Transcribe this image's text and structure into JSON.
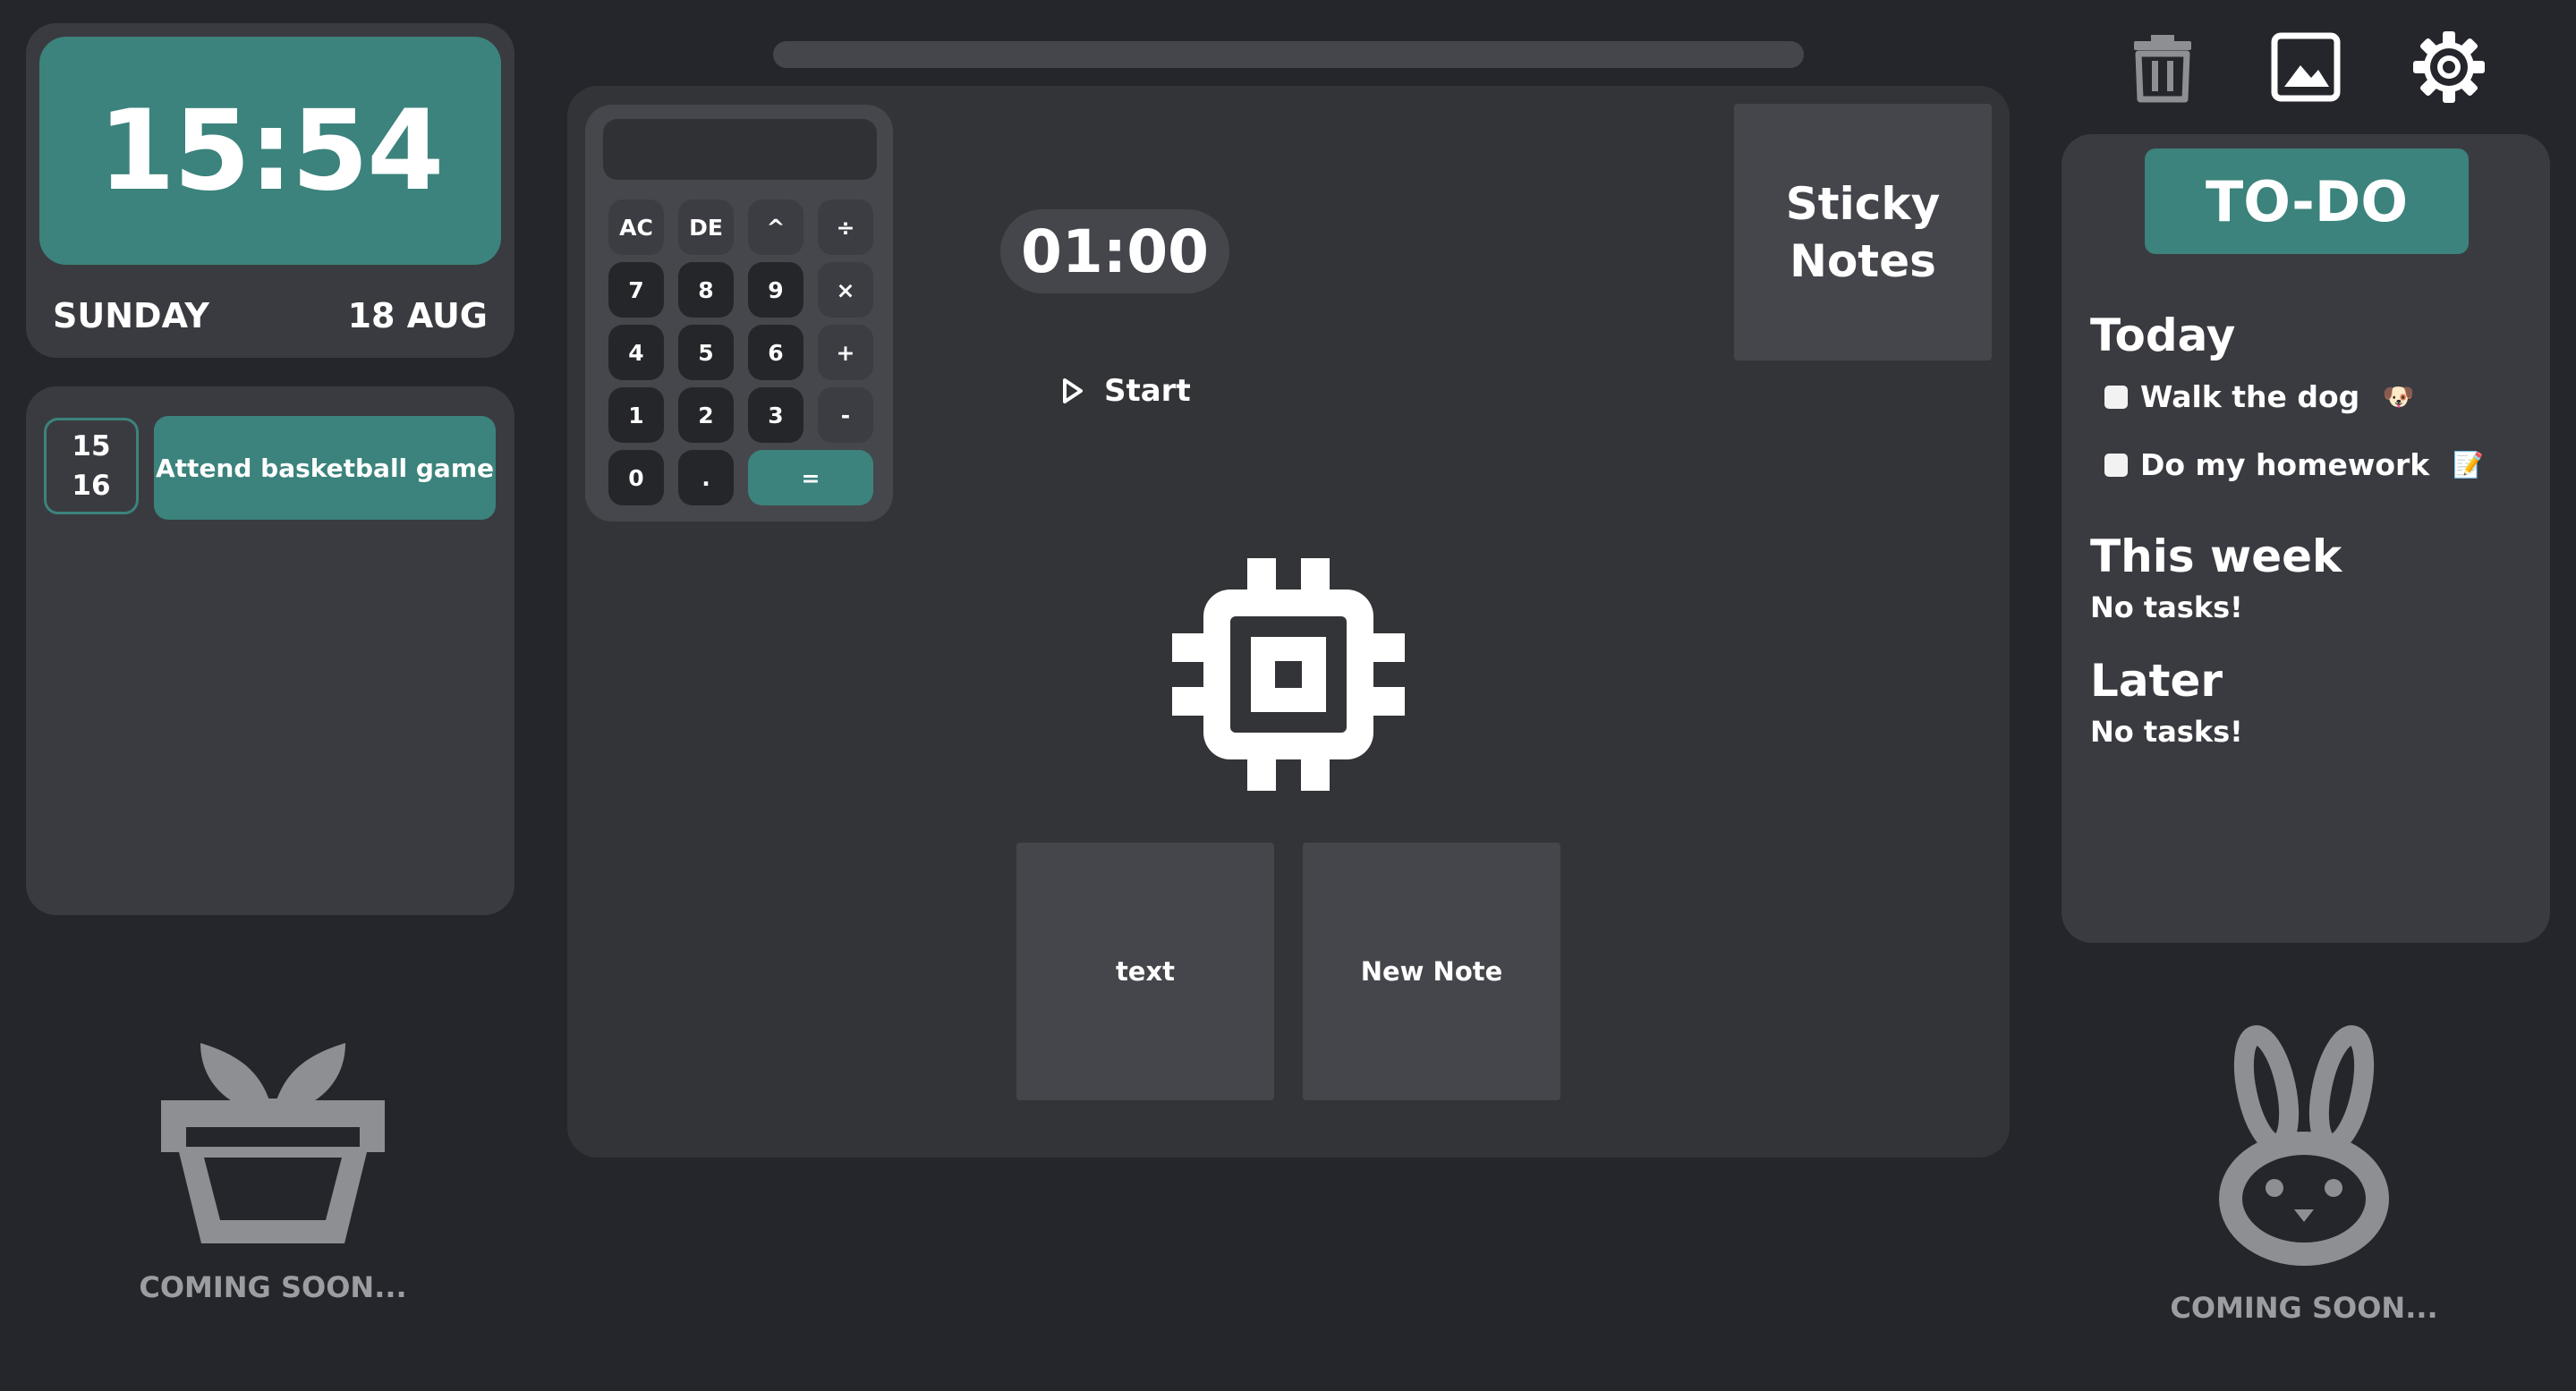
{
  "clock": {
    "time": "15:54",
    "day": "SUNDAY",
    "date": "18 AUG"
  },
  "events": [
    {
      "start": "15",
      "end": "16",
      "title": "Attend basketball game"
    }
  ],
  "plant_widget": {
    "label": "COMING SOON..."
  },
  "pet_widget": {
    "label": "COMING SOON..."
  },
  "calculator": {
    "display": "",
    "keys": [
      "AC",
      "DE",
      "^",
      "÷",
      "7",
      "8",
      "9",
      "×",
      "4",
      "5",
      "6",
      "+",
      "1",
      "2",
      "3",
      "-",
      "0",
      ".",
      "="
    ]
  },
  "timer": {
    "time": "01:00",
    "start_label": "Start"
  },
  "sticky_notes": {
    "title_line1": "Sticky",
    "title_line2": "Notes",
    "notes": [
      "text",
      "New Note"
    ]
  },
  "toolbar": {
    "icons": [
      "trash-icon",
      "image-icon",
      "gear-icon"
    ]
  },
  "todo": {
    "title": "TO-DO",
    "today": {
      "title": "Today",
      "tasks": [
        {
          "text": "Walk the dog",
          "emoji": "🐶"
        },
        {
          "text": "Do my homework",
          "emoji": "📝"
        }
      ]
    },
    "this_week": {
      "title": "This week",
      "empty": "No tasks!"
    },
    "later": {
      "title": "Later",
      "empty": "No tasks!"
    }
  },
  "colors": {
    "background": "#25262b",
    "card": "#3a3b40",
    "accent": "#3b837c",
    "muted_icon": "#8e8f93"
  }
}
